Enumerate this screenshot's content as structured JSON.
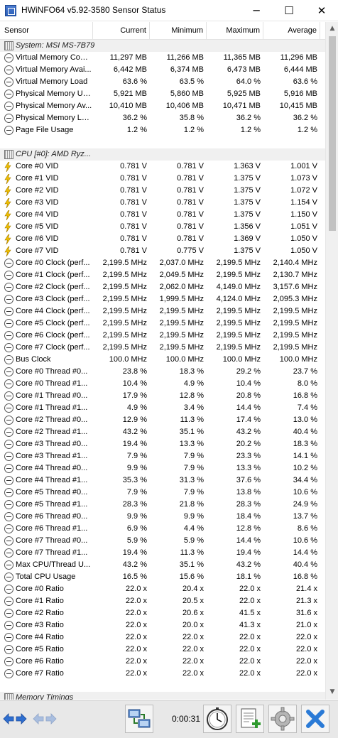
{
  "window": {
    "title": "HWiNFO64 v5.92-3580 Sensor Status",
    "minimize_glyph": "─",
    "maximize_glyph": "☐",
    "close_glyph": "✕"
  },
  "columns": {
    "sensor": "Sensor",
    "current": "Current",
    "minimum": "Minimum",
    "maximum": "Maximum",
    "average": "Average"
  },
  "rows": [
    {
      "kind": "group",
      "icon": "chip-icon",
      "name": "System: MSI MS-7B79"
    },
    {
      "kind": "data",
      "icon": "clock-icon",
      "name": "Virtual Memory Com...",
      "current": "11,297 MB",
      "minimum": "11,266 MB",
      "maximum": "11,365 MB",
      "average": "11,296 MB"
    },
    {
      "kind": "data",
      "icon": "clock-icon",
      "name": "Virtual Memory Avai...",
      "current": "6,442 MB",
      "minimum": "6,374 MB",
      "maximum": "6,473 MB",
      "average": "6,444 MB"
    },
    {
      "kind": "data",
      "icon": "clock-icon",
      "name": "Virtual Memory Load",
      "current": "63.6 %",
      "minimum": "63.5 %",
      "maximum": "64.0 %",
      "average": "63.6 %"
    },
    {
      "kind": "data",
      "icon": "clock-icon",
      "name": "Physical Memory Used",
      "current": "5,921 MB",
      "minimum": "5,860 MB",
      "maximum": "5,925 MB",
      "average": "5,916 MB"
    },
    {
      "kind": "data",
      "icon": "clock-icon",
      "name": "Physical Memory Av...",
      "current": "10,410 MB",
      "minimum": "10,406 MB",
      "maximum": "10,471 MB",
      "average": "10,415 MB"
    },
    {
      "kind": "data",
      "icon": "clock-icon",
      "name": "Physical Memory Load",
      "current": "36.2 %",
      "minimum": "35.8 %",
      "maximum": "36.2 %",
      "average": "36.2 %"
    },
    {
      "kind": "data",
      "icon": "clock-icon",
      "name": "Page File Usage",
      "current": "1.2 %",
      "minimum": "1.2 %",
      "maximum": "1.2 %",
      "average": "1.2 %"
    },
    {
      "kind": "spacer"
    },
    {
      "kind": "group",
      "icon": "chip-icon",
      "name": "CPU [#0]: AMD Ryz..."
    },
    {
      "kind": "data",
      "icon": "bolt-icon",
      "name": "Core #0 VID",
      "current": "0.781 V",
      "minimum": "0.781 V",
      "maximum": "1.363 V",
      "average": "1.001 V"
    },
    {
      "kind": "data",
      "icon": "bolt-icon",
      "name": "Core #1 VID",
      "current": "0.781 V",
      "minimum": "0.781 V",
      "maximum": "1.375 V",
      "average": "1.073 V"
    },
    {
      "kind": "data",
      "icon": "bolt-icon",
      "name": "Core #2 VID",
      "current": "0.781 V",
      "minimum": "0.781 V",
      "maximum": "1.375 V",
      "average": "1.072 V"
    },
    {
      "kind": "data",
      "icon": "bolt-icon",
      "name": "Core #3 VID",
      "current": "0.781 V",
      "minimum": "0.781 V",
      "maximum": "1.375 V",
      "average": "1.154 V"
    },
    {
      "kind": "data",
      "icon": "bolt-icon",
      "name": "Core #4 VID",
      "current": "0.781 V",
      "minimum": "0.781 V",
      "maximum": "1.375 V",
      "average": "1.150 V"
    },
    {
      "kind": "data",
      "icon": "bolt-icon",
      "name": "Core #5 VID",
      "current": "0.781 V",
      "minimum": "0.781 V",
      "maximum": "1.356 V",
      "average": "1.051 V"
    },
    {
      "kind": "data",
      "icon": "bolt-icon",
      "name": "Core #6 VID",
      "current": "0.781 V",
      "minimum": "0.781 V",
      "maximum": "1.369 V",
      "average": "1.050 V"
    },
    {
      "kind": "data",
      "icon": "bolt-icon",
      "name": "Core #7 VID",
      "current": "0.781 V",
      "minimum": "0.775 V",
      "maximum": "1.375 V",
      "average": "1.050 V"
    },
    {
      "kind": "data",
      "icon": "clock-icon",
      "name": "Core #0 Clock (perf...",
      "current": "2,199.5 MHz",
      "minimum": "2,037.0 MHz",
      "maximum": "2,199.5 MHz",
      "average": "2,140.4 MHz"
    },
    {
      "kind": "data",
      "icon": "clock-icon",
      "name": "Core #1 Clock (perf...",
      "current": "2,199.5 MHz",
      "minimum": "2,049.5 MHz",
      "maximum": "2,199.5 MHz",
      "average": "2,130.7 MHz"
    },
    {
      "kind": "data",
      "icon": "clock-icon",
      "name": "Core #2 Clock (perf...",
      "current": "2,199.5 MHz",
      "minimum": "2,062.0 MHz",
      "maximum": "4,149.0 MHz",
      "average": "3,157.6 MHz"
    },
    {
      "kind": "data",
      "icon": "clock-icon",
      "name": "Core #3 Clock (perf...",
      "current": "2,199.5 MHz",
      "minimum": "1,999.5 MHz",
      "maximum": "4,124.0 MHz",
      "average": "2,095.3 MHz"
    },
    {
      "kind": "data",
      "icon": "clock-icon",
      "name": "Core #4 Clock (perf...",
      "current": "2,199.5 MHz",
      "minimum": "2,199.5 MHz",
      "maximum": "2,199.5 MHz",
      "average": "2,199.5 MHz"
    },
    {
      "kind": "data",
      "icon": "clock-icon",
      "name": "Core #5 Clock (perf...",
      "current": "2,199.5 MHz",
      "minimum": "2,199.5 MHz",
      "maximum": "2,199.5 MHz",
      "average": "2,199.5 MHz"
    },
    {
      "kind": "data",
      "icon": "clock-icon",
      "name": "Core #6 Clock (perf...",
      "current": "2,199.5 MHz",
      "minimum": "2,199.5 MHz",
      "maximum": "2,199.5 MHz",
      "average": "2,199.5 MHz"
    },
    {
      "kind": "data",
      "icon": "clock-icon",
      "name": "Core #7 Clock (perf...",
      "current": "2,199.5 MHz",
      "minimum": "2,199.5 MHz",
      "maximum": "2,199.5 MHz",
      "average": "2,199.5 MHz"
    },
    {
      "kind": "data",
      "icon": "clock-icon",
      "name": "Bus Clock",
      "current": "100.0 MHz",
      "minimum": "100.0 MHz",
      "maximum": "100.0 MHz",
      "average": "100.0 MHz"
    },
    {
      "kind": "data",
      "icon": "clock-icon",
      "name": "Core #0 Thread #0...",
      "current": "23.8 %",
      "minimum": "18.3 %",
      "maximum": "29.2 %",
      "average": "23.7 %"
    },
    {
      "kind": "data",
      "icon": "clock-icon",
      "name": "Core #0 Thread #1...",
      "current": "10.4 %",
      "minimum": "4.9 %",
      "maximum": "10.4 %",
      "average": "8.0 %"
    },
    {
      "kind": "data",
      "icon": "clock-icon",
      "name": "Core #1 Thread #0...",
      "current": "17.9 %",
      "minimum": "12.8 %",
      "maximum": "20.8 %",
      "average": "16.8 %"
    },
    {
      "kind": "data",
      "icon": "clock-icon",
      "name": "Core #1 Thread #1...",
      "current": "4.9 %",
      "minimum": "3.4 %",
      "maximum": "14.4 %",
      "average": "7.4 %"
    },
    {
      "kind": "data",
      "icon": "clock-icon",
      "name": "Core #2 Thread #0...",
      "current": "12.9 %",
      "minimum": "11.3 %",
      "maximum": "17.4 %",
      "average": "13.0 %"
    },
    {
      "kind": "data",
      "icon": "clock-icon",
      "name": "Core #2 Thread #1...",
      "current": "43.2 %",
      "minimum": "35.1 %",
      "maximum": "43.2 %",
      "average": "40.4 %"
    },
    {
      "kind": "data",
      "icon": "clock-icon",
      "name": "Core #3 Thread #0...",
      "current": "19.4 %",
      "minimum": "13.3 %",
      "maximum": "20.2 %",
      "average": "18.3 %"
    },
    {
      "kind": "data",
      "icon": "clock-icon",
      "name": "Core #3 Thread #1...",
      "current": "7.9 %",
      "minimum": "7.9 %",
      "maximum": "23.3 %",
      "average": "14.1 %"
    },
    {
      "kind": "data",
      "icon": "clock-icon",
      "name": "Core #4 Thread #0...",
      "current": "9.9 %",
      "minimum": "7.9 %",
      "maximum": "13.3 %",
      "average": "10.2 %"
    },
    {
      "kind": "data",
      "icon": "clock-icon",
      "name": "Core #4 Thread #1...",
      "current": "35.3 %",
      "minimum": "31.3 %",
      "maximum": "37.6 %",
      "average": "34.4 %"
    },
    {
      "kind": "data",
      "icon": "clock-icon",
      "name": "Core #5 Thread #0...",
      "current": "7.9 %",
      "minimum": "7.9 %",
      "maximum": "13.8 %",
      "average": "10.6 %"
    },
    {
      "kind": "data",
      "icon": "clock-icon",
      "name": "Core #5 Thread #1...",
      "current": "28.3 %",
      "minimum": "21.8 %",
      "maximum": "28.3 %",
      "average": "24.9 %"
    },
    {
      "kind": "data",
      "icon": "clock-icon",
      "name": "Core #6 Thread #0...",
      "current": "9.9 %",
      "minimum": "9.9 %",
      "maximum": "18.4 %",
      "average": "13.7 %"
    },
    {
      "kind": "data",
      "icon": "clock-icon",
      "name": "Core #6 Thread #1...",
      "current": "6.9 %",
      "minimum": "4.4 %",
      "maximum": "12.8 %",
      "average": "8.6 %"
    },
    {
      "kind": "data",
      "icon": "clock-icon",
      "name": "Core #7 Thread #0...",
      "current": "5.9 %",
      "minimum": "5.9 %",
      "maximum": "14.4 %",
      "average": "10.6 %"
    },
    {
      "kind": "data",
      "icon": "clock-icon",
      "name": "Core #7 Thread #1...",
      "current": "19.4 %",
      "minimum": "11.3 %",
      "maximum": "19.4 %",
      "average": "14.4 %"
    },
    {
      "kind": "data",
      "icon": "clock-icon",
      "name": "Max CPU/Thread U...",
      "current": "43.2 %",
      "minimum": "35.1 %",
      "maximum": "43.2 %",
      "average": "40.4 %"
    },
    {
      "kind": "data",
      "icon": "clock-icon",
      "name": "Total CPU Usage",
      "current": "16.5 %",
      "minimum": "15.6 %",
      "maximum": "18.1 %",
      "average": "16.8 %"
    },
    {
      "kind": "data",
      "icon": "clock-icon",
      "name": "Core #0 Ratio",
      "current": "22.0 x",
      "minimum": "20.4 x",
      "maximum": "22.0 x",
      "average": "21.4 x"
    },
    {
      "kind": "data",
      "icon": "clock-icon",
      "name": "Core #1 Ratio",
      "current": "22.0 x",
      "minimum": "20.5 x",
      "maximum": "22.0 x",
      "average": "21.3 x"
    },
    {
      "kind": "data",
      "icon": "clock-icon",
      "name": "Core #2 Ratio",
      "current": "22.0 x",
      "minimum": "20.6 x",
      "maximum": "41.5 x",
      "average": "31.6 x"
    },
    {
      "kind": "data",
      "icon": "clock-icon",
      "name": "Core #3 Ratio",
      "current": "22.0 x",
      "minimum": "20.0 x",
      "maximum": "41.3 x",
      "average": "21.0 x"
    },
    {
      "kind": "data",
      "icon": "clock-icon",
      "name": "Core #4 Ratio",
      "current": "22.0 x",
      "minimum": "22.0 x",
      "maximum": "22.0 x",
      "average": "22.0 x"
    },
    {
      "kind": "data",
      "icon": "clock-icon",
      "name": "Core #5 Ratio",
      "current": "22.0 x",
      "minimum": "22.0 x",
      "maximum": "22.0 x",
      "average": "22.0 x"
    },
    {
      "kind": "data",
      "icon": "clock-icon",
      "name": "Core #6 Ratio",
      "current": "22.0 x",
      "minimum": "22.0 x",
      "maximum": "22.0 x",
      "average": "22.0 x"
    },
    {
      "kind": "data",
      "icon": "clock-icon",
      "name": "Core #7 Ratio",
      "current": "22.0 x",
      "minimum": "22.0 x",
      "maximum": "22.0 x",
      "average": "22.0 x"
    },
    {
      "kind": "spacer"
    },
    {
      "kind": "group",
      "icon": "chip-icon",
      "name": "Memory Timings"
    }
  ],
  "toolbar": {
    "elapsed_time": "0:00:31",
    "buttons": {
      "nav_forward_back": "navigate-arrows-icon",
      "nav_disabled": "navigate-arrows-disabled-icon",
      "network": "network-computers-icon",
      "stopwatch": "stopwatch-icon",
      "add_log": "add-log-icon",
      "settings": "settings-gear-icon",
      "close": "close-x-icon"
    }
  },
  "colors": {
    "accent_blue": "#2f6fd0",
    "bolt_yellow": "#f0c000",
    "close_x_blue": "#2a7ad6",
    "toolbar_bg": "#e8e8e8"
  }
}
